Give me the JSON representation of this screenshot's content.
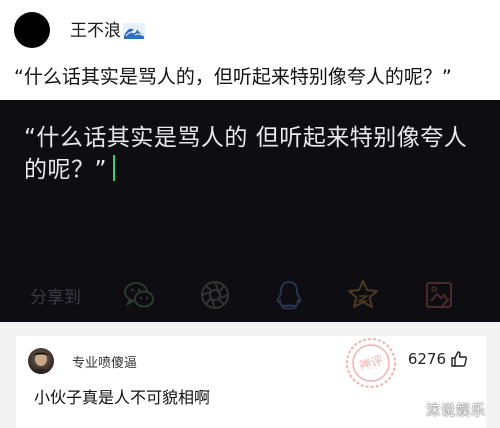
{
  "post": {
    "author": "王不浪",
    "author_badge_icon": "wave-icon",
    "text": "“什么话其实是骂人的，但听起来特别像夸人的呢？”"
  },
  "share_panel": {
    "quote_line1": "“什么话其实是骂人的  但听起来特别像夸人",
    "quote_line2": "的呢？”",
    "share_label": "分享到",
    "icons": [
      "wechat-icon",
      "moments-icon",
      "qq-icon",
      "favorite-star-icon",
      "image-icon"
    ],
    "background_color": "#0d0d12",
    "cursor_color": "#33d17a"
  },
  "comment": {
    "username": "专业喷傻逼",
    "likes": "6276",
    "text": "小伙子真是人不可貌相啊"
  },
  "watermark": {
    "text": "沫说娱乐",
    "stamp_text": "神评"
  }
}
